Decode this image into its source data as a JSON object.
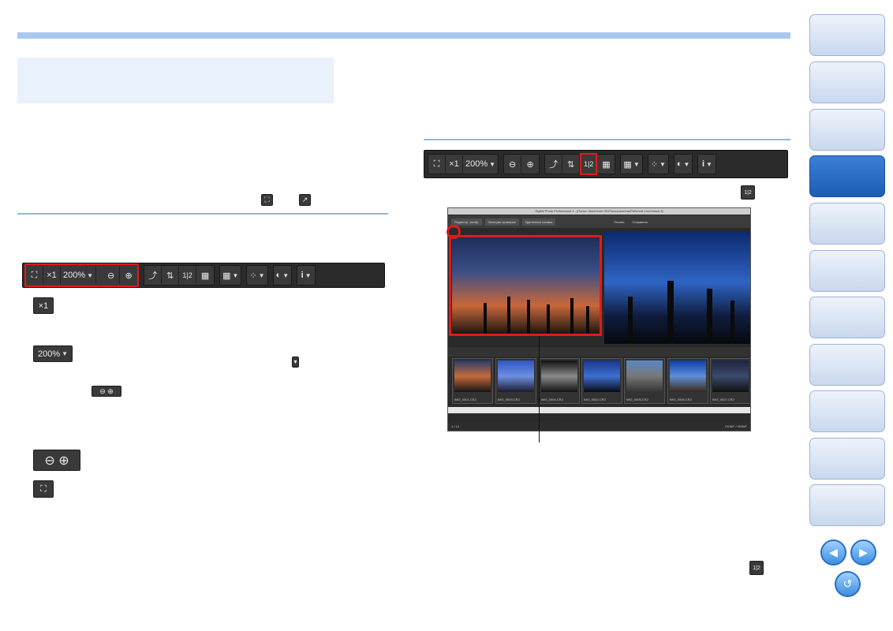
{
  "toolbar": {
    "zoom_x1": "×1",
    "zoom_value": "200%",
    "dropdown_glyph": "▼",
    "info_glyph": "i",
    "compare_glyph": "1|2"
  },
  "screenshot": {
    "window_title": "Digital Photo Professional 4 - [Папка: Macintosh HD/Пользователи/Рабочий стол/папка 3]",
    "tabs": [
      "Редактор. изобр.",
      "Быстрая проверка",
      "Удаленная съемка"
    ],
    "print_label": "Печать",
    "save_label": "Сохранить",
    "status_left": "1 / 12",
    "status_right": "IЗОБР. / IЗОБР.",
    "filter_label": "Фильтр: Выкл.",
    "thumbnails": [
      "IMG_0001.CR2",
      "IMG_0003.CR2",
      "IMG_0004.CR2",
      "IMG_0002.CR2",
      "IMG_0005.CR2",
      "IMG_0006.CR2",
      "IMG_0007.CR2"
    ]
  },
  "colors": {
    "accent_blue": "#a9c9f0",
    "highlight_red": "#e01b1b",
    "nav_active": "#1c5db3"
  },
  "nav": {
    "prev_icon": "arrow-left-icon",
    "next_icon": "arrow-right-icon",
    "return_icon": "return-icon"
  }
}
